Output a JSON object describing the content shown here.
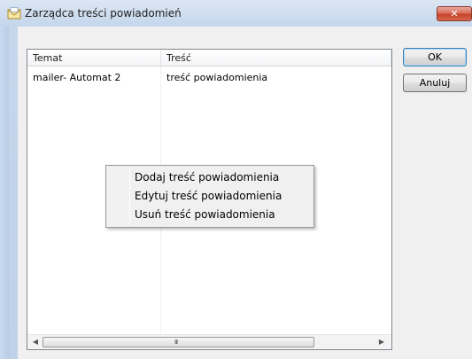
{
  "window": {
    "title": "Zarządca treści powiadomień",
    "close_label": "x",
    "title_icon": "envelope-icon"
  },
  "list": {
    "columns": [
      "Temat",
      "Treść"
    ],
    "rows": [
      {
        "temat": "mailer- Automat 2",
        "tresc": "treść powiadomienia"
      }
    ],
    "scroll_grip": "III"
  },
  "buttons": {
    "ok": "OK",
    "cancel": "Anuluj"
  },
  "context_menu": {
    "items": [
      "Dodaj treść powiadomienia",
      "Edytuj treść powiadomienia",
      "Usuń treść powiadomienia"
    ]
  }
}
